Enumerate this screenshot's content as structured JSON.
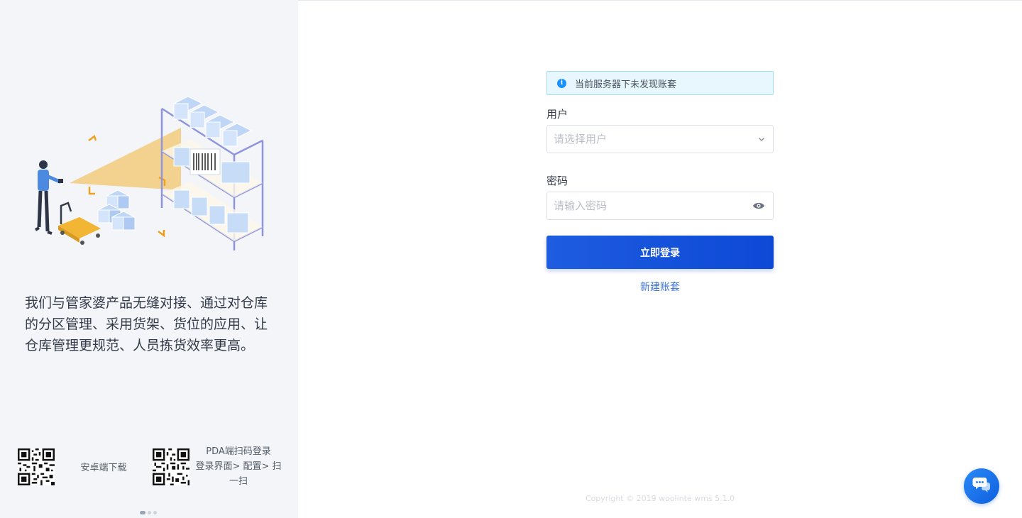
{
  "promo": {
    "text": "我们与管家婆产品无缝对接、通过对仓库的分区管理、采用货架、货位的应用、让仓库管理更规范、人员拣货效率更高。"
  },
  "downloads": {
    "android_label": "安卓端下载",
    "pda_line1": "PDA端扫码登录",
    "pda_line2": "登录界面> 配置> 扫一扫"
  },
  "carousel": {
    "count": 3,
    "active": 0
  },
  "alert": {
    "icon": "info-icon",
    "text": "当前服务器下未发现账套"
  },
  "form": {
    "user_label": "用户",
    "user_placeholder": "请选择用户",
    "password_label": "密码",
    "password_placeholder": "请输入密码",
    "login_button": "立即登录",
    "new_account_link": "新建账套"
  },
  "footer": {
    "copyright": "Copyright © 2019 woolinte wms 5.1.0"
  },
  "colors": {
    "primary": "#1452db",
    "link": "#3a72d8",
    "alert_bg": "#e8f6fd",
    "alert_border": "#a6dcf3",
    "info": "#1890ff",
    "left_panel_bg": "#f3f5f9"
  },
  "icons": {
    "select_suffix": "chevron-down-icon",
    "password_suffix": "eye-icon",
    "floating": "chat-bubble-icon"
  }
}
